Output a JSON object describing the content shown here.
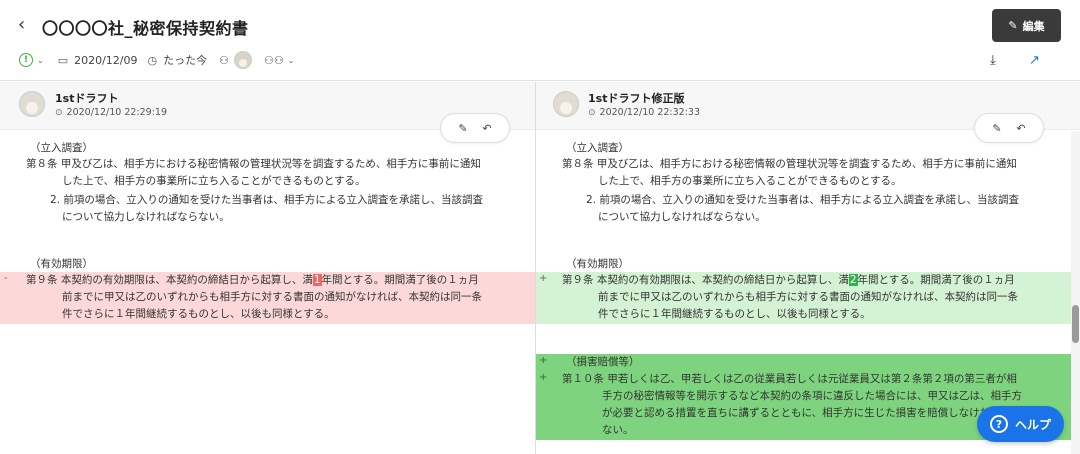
{
  "header": {
    "back_icon": "‹",
    "title": "〇〇〇〇社_秘密保持契約書",
    "edit_label": "編集",
    "edit_icon": "✎",
    "date": "2020/12/09",
    "updated": "たった今",
    "icons": {
      "status": "!",
      "calendar": "▭",
      "clock": "◷",
      "person": "⚇",
      "people": "⚇⚇",
      "chev": "⌄",
      "download": "⤓",
      "external": "↗"
    }
  },
  "left_version": {
    "name": "1stドラフト",
    "time": "2020/12/10 22:29:19"
  },
  "right_version": {
    "name": "1stドラフト修正版",
    "time": "2020/12/10 22:32:33"
  },
  "tools": {
    "annotate": "✎",
    "reply": "↶"
  },
  "left": {
    "lines": [
      "（立入調査）",
      "第８条 甲及び乙は、相手方における秘密情報の管理状況等を調査するため、相手方に事前に通知",
      "した上で、相手方の事業所に立ち入ることができるものとする。",
      "2. 前項の場合、立入りの通知を受けた当事者は、相手方による立入調査を承諾し、当該調査",
      "について協力しなければならない。",
      "（有効期限）"
    ],
    "changed": {
      "marker": "-",
      "pre": "第９条 本契約の有効期限は、本契約の締結日から起算し、満",
      "mark": "1",
      "post": "年間とする。期間満了後の１ヵ月",
      "l2": "前までに甲又は乙のいずれからも相手方に対する書面の通知がなければ、本契約は同一条",
      "l3": "件でさらに１年間継続するものとし、以後も同様とする。"
    }
  },
  "right": {
    "lines": [
      "（立入調査）",
      "第８条 甲及び乙は、相手方における秘密情報の管理状況等を調査するため、相手方に事前に通知",
      "した上で、相手方の事業所に立ち入ることができるものとする。",
      "2. 前項の場合、立入りの通知を受けた当事者は、相手方による立入調査を承諾し、当該調査",
      "について協力しなければならない。",
      "（有効期限）"
    ],
    "changed": {
      "marker": "+",
      "pre": "第９条 本契約の有効期限は、本契約の締結日から起算し、満",
      "mark": "2",
      "post": "年間とする。期間満了後の１ヵ月",
      "l2": "前までに甲又は乙のいずれからも相手方に対する書面の通知がなければ、本契約は同一条",
      "l3": "件でさらに１年間継続するものとし、以後も同様とする。"
    },
    "added": {
      "marker": "+",
      "heading": "（損害賠償等）",
      "l1": "第１０条 甲若しくは乙、甲若しくは乙の従業員若しくは元従業員又は第２条第２項の第三者が相",
      "l2": "手方の秘密情報等を開示するなど本契約の条項に違反した場合には、甲又は乙は、相手方",
      "l3": "が必要と認める措置を直ちに講ずるとともに、相手方に生じた損害を賠償しなければなら",
      "l4": "ない。"
    }
  },
  "help": {
    "icon": "?",
    "label": "ヘルプ"
  },
  "colors": {
    "deleted_bg": "#fdd8d8",
    "changed_bg": "#d4f2d4",
    "added_bg": "#7ed47e",
    "accent": "#1a73e8"
  }
}
